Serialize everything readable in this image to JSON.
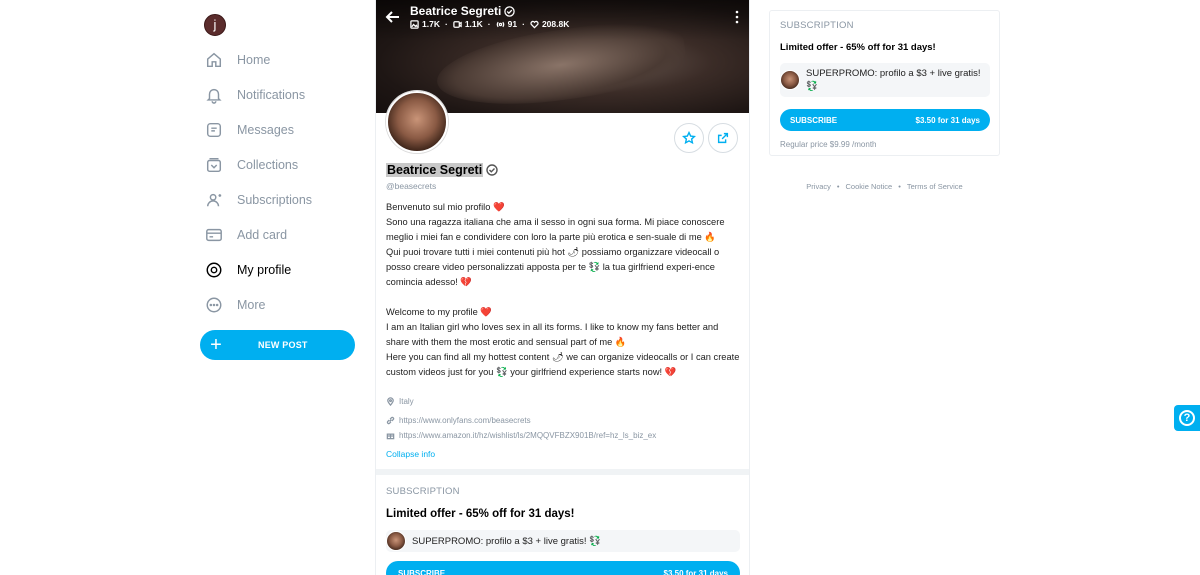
{
  "user": {
    "initial": "j"
  },
  "nav": [
    {
      "label": "Home",
      "icon": "home-icon"
    },
    {
      "label": "Notifications",
      "icon": "bell-icon"
    },
    {
      "label": "Messages",
      "icon": "message-icon"
    },
    {
      "label": "Collections",
      "icon": "collections-icon"
    },
    {
      "label": "Subscriptions",
      "icon": "subscriptions-icon"
    },
    {
      "label": "Add card",
      "icon": "card-icon"
    },
    {
      "label": "My profile",
      "icon": "profile-icon",
      "active": true
    },
    {
      "label": "More",
      "icon": "more-dots-icon"
    }
  ],
  "new_post_label": "NEW POST",
  "profile": {
    "name": "Beatrice Segreti",
    "handle": "@beasecrets",
    "stats": {
      "photos": "1.7K",
      "videos": "1.1K",
      "streams": "91",
      "likes": "208.8K"
    },
    "bio_it": "Benvenuto sul mio profilo ❤️\nSono una ragazza italiana che ama il sesso in ogni sua forma. Mi piace conoscere meglio i miei fan e condividere con loro la parte più erotica e sen-suale di me 🔥\nQui puoi trovare tutti i miei contenuti più hot 🌶 possiamo organizzare videocall o posso creare video personalizzati apposta per te 💱 la tua girlfriend experi-ence comincia adesso! 💔",
    "bio_en": "Welcome to my profile ❤️\nI am an Italian girl who loves sex in all its forms. I like to know my fans better and share with them the most erotic and sensual part of me 🔥\nHere you can find all my hottest content 🌶 we can organize videocalls or I can create custom videos just for you 💱 your girlfriend experience starts now! 💔",
    "location": "Italy",
    "link1": "https://www.onlyfans.com/beasecrets",
    "link2": "https://www.amazon.it/hz/wishlist/ls/2MQQVFBZX901B/ref=hz_ls_biz_ex",
    "collapse_label": "Collapse info"
  },
  "subscription": {
    "title": "SUBSCRIPTION",
    "offer": "Limited offer - 65% off for 31 days!",
    "promo_text": "SUPERPROMO: profilo a $3 + live gratis! 💱",
    "button_label": "SUBSCRIBE",
    "button_price": "$3.50 for 31 days",
    "regular_price": "Regular price $9.99 /month"
  },
  "footer": {
    "privacy": "Privacy",
    "cookie": "Cookie Notice",
    "terms": "Terms of Service"
  },
  "colors": {
    "accent": "#00aff0",
    "muted": "#8a96a3"
  }
}
